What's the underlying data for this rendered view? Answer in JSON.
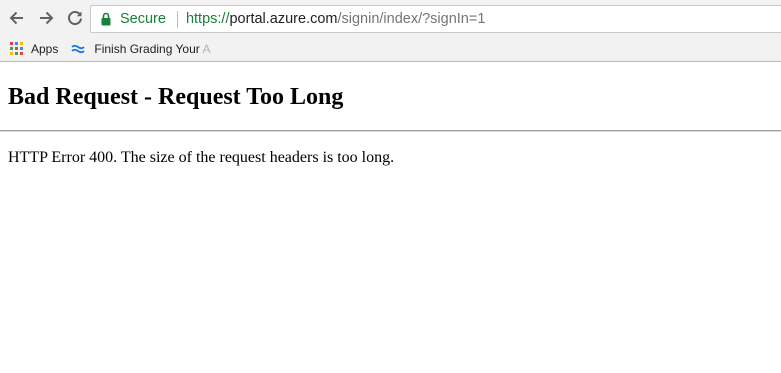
{
  "browser": {
    "security_label": "Secure",
    "url": {
      "scheme": "https://",
      "host": "portal.azure.com",
      "path": "/signin/index/?signIn=1"
    },
    "nav_icons": [
      "back-arrow-icon",
      "forward-arrow-icon",
      "reload-icon"
    ],
    "bookmarks": [
      {
        "icon": "apps-grid-icon",
        "label": "Apps"
      },
      {
        "icon": "wave-icon",
        "label": "Finish Grading Your",
        "label_faded": "A"
      }
    ]
  },
  "page": {
    "heading": "Bad Request - Request Too Long",
    "message": "HTTP Error 400. The size of the request headers is too long."
  },
  "colors": {
    "secure_green": "#188038",
    "chrome_bg": "#f2f2f2",
    "url_path_gray": "#757575"
  }
}
